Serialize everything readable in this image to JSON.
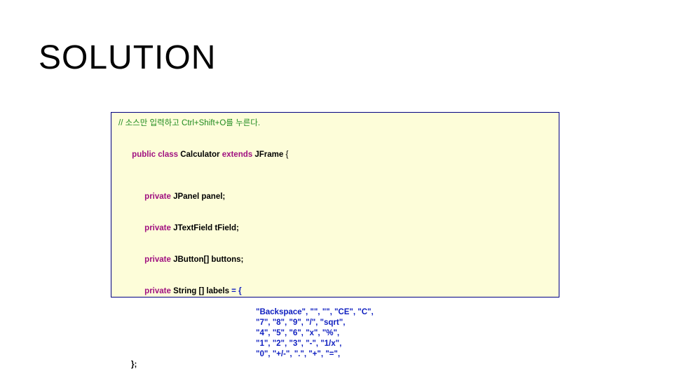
{
  "slide": {
    "title": "SOLUTION"
  },
  "code": {
    "comment": "// 소스만 입력하고 Ctrl+Shift+O를 누른다.",
    "kw_public": "public",
    "kw_class": "class",
    "cls_name": "Calculator",
    "kw_extends": "extends",
    "super_name": "JFrame",
    "brace_open": " {",
    "kw_private": "private",
    "type_jpanel": "JPanel",
    "name_panel": "panel",
    "type_jtextfield": "JTextField",
    "name_tfield": "tField",
    "type_jbutton_arr": "JButton[]",
    "name_buttons": "buttons",
    "type_string_arr": "String []",
    "name_labels": "labels",
    "assign": " = {",
    "semi": ";",
    "arr_line1": "\"Backspace\", \"\", \"\", \"CE\", \"C\",",
    "arr_line2": "\"7\", \"8\", \"9\", \"/\", \"sqrt\",",
    "arr_line3": "\"4\", \"5\", \"6\", \"x\", \"%\",",
    "arr_line4": "\"1\", \"2\", \"3\", \"-\", \"1/x\",",
    "arr_line5": "\"0\", \"+/-\", \".\", \"+\", \"=\",",
    "close": "};"
  }
}
